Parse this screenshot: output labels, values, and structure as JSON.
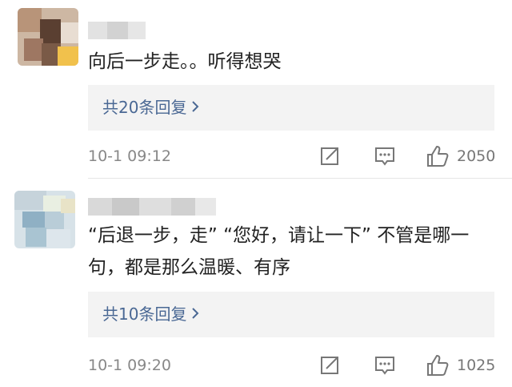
{
  "comments": [
    {
      "text": "向后一步走。。听得想哭",
      "replies_label": "共20条回复",
      "time": "10-1 09:12",
      "likes": "2050"
    },
    {
      "text": "“后退一步，走” “您好，请让一下” 不管是哪一句，都是那么温暖、有序",
      "replies_label": "共10条回复",
      "time": "10-1 09:20",
      "likes": "1025"
    }
  ],
  "icons": {
    "reply_chevron": "chevron-right-icon",
    "share": "share-icon",
    "comment": "comment-icon",
    "like": "thumbs-up-icon"
  },
  "colors": {
    "reply_link": "#4a6894",
    "reply_background": "#f3f3f3",
    "meta_text": "#888888"
  }
}
